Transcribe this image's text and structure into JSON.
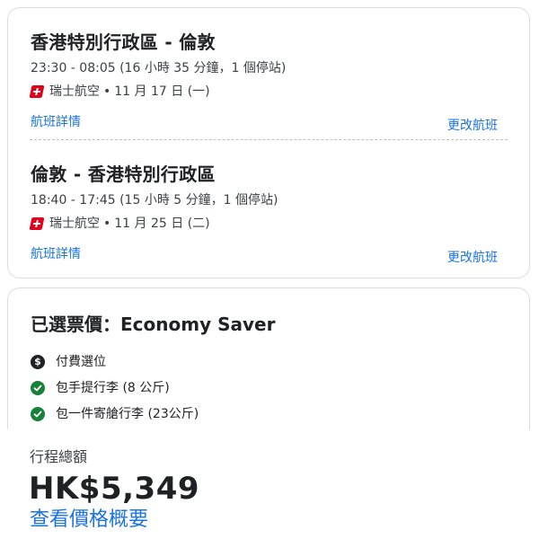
{
  "outbound": {
    "route": "香港特別行政區 - 倫敦",
    "times": "23:30 - 08:05 (16 小時 35 分鐘，1 個停站)",
    "airline": "瑞士航空",
    "separator": "•",
    "date": "11 月 17 日 (一)",
    "details_link": "航班詳情",
    "change_link": "更改航班"
  },
  "return": {
    "route": "倫敦 - 香港特別行政區",
    "times": "18:40 - 17:45 (15 小時 5 分鐘，1 個停站)",
    "airline": "瑞士航空",
    "separator": "•",
    "date": "11 月 25 日 (二)",
    "details_link": "航班詳情",
    "change_link": "更改航班"
  },
  "fare": {
    "title": "已選票價：Economy Saver",
    "features": [
      {
        "icon": "dollar-icon",
        "label": "付費選位"
      },
      {
        "icon": "check-icon",
        "label": "包手提行李 (8 公斤)"
      },
      {
        "icon": "check-icon",
        "label": "包一件寄艙行李 (23公斤)"
      }
    ]
  },
  "total": {
    "label": "行程總額",
    "price": "HK$5,349",
    "price_link": "查看價格概要"
  },
  "colors": {
    "link": "#1a73e8",
    "check": "#188038",
    "swiss_red": "#e2001a"
  }
}
